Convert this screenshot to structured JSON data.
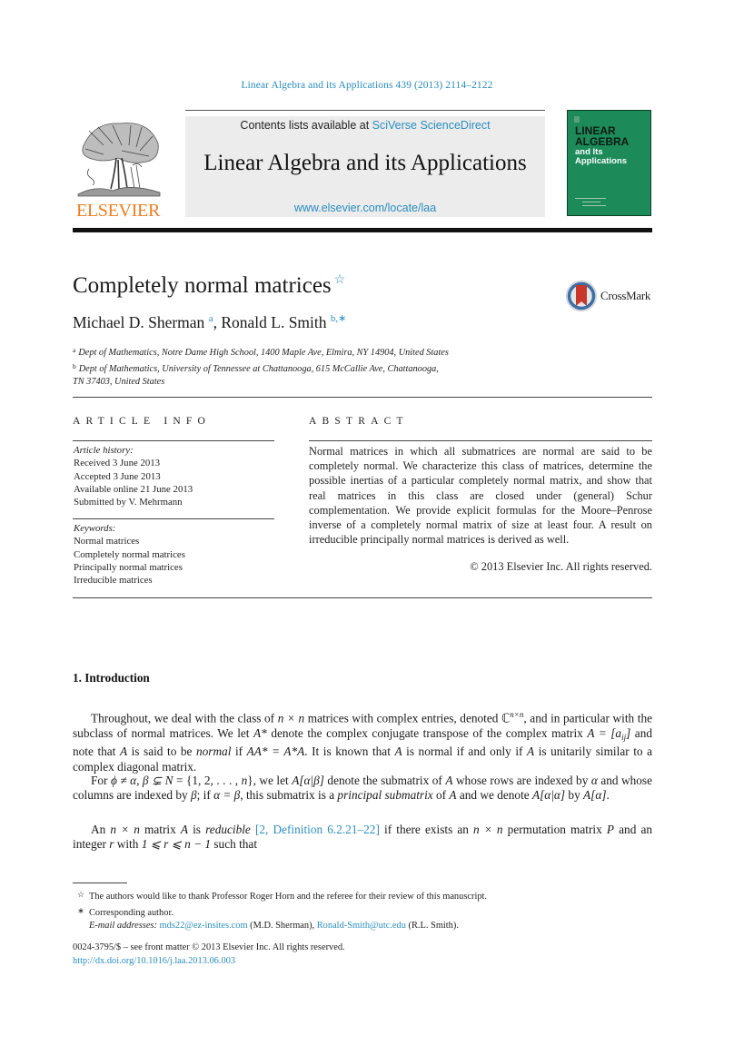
{
  "running_head": "Linear Algebra and its Applications 439 (2013) 2114–2122",
  "masthead": {
    "publisher_logo_text": "ELSEVIER",
    "contents_prefix": "Contents lists available at ",
    "contents_link": "SciVerse ScienceDirect",
    "journal_name": "Linear Algebra and its Applications",
    "journal_url": "www.elsevier.com/locate/laa",
    "cover": {
      "title_line1": "LINEAR",
      "title_line2": "ALGEBRA",
      "subtitle_line1": "and Its",
      "subtitle_line2": "Applications"
    }
  },
  "colors": {
    "link": "#2a8ec0",
    "elsevier_orange": "#f07c1f",
    "cover_green": "#1d8a5a",
    "masthead_gray": "#ececec"
  },
  "article": {
    "title": "Completely normal matrices",
    "title_footnote_mark": "☆",
    "crossmark_label": "CrossMark",
    "authors": [
      {
        "name": "Michael D. Sherman",
        "affiliation_mark": "a"
      },
      {
        "name": "Ronald L. Smith",
        "affiliation_mark": "b,∗"
      }
    ],
    "author_separator": ", ",
    "affiliations": [
      {
        "mark": "a",
        "text": "Dept of Mathematics, Notre Dame High School, 1400 Maple Ave, Elmira, NY 14904, United States"
      },
      {
        "mark": "b",
        "text": "Dept of Mathematics, University of Tennessee at Chattanooga, 615 McCallie Ave, Chattanooga,"
      },
      {
        "mark": "",
        "text": "TN 37403, United States"
      }
    ]
  },
  "article_info": {
    "heading": "ARTICLE INFO",
    "history_label": "Article history:",
    "history": [
      "Received 3 June 2013",
      "Accepted 3 June 2013",
      "Available online 21 June 2013",
      "Submitted by V. Mehrmann"
    ],
    "keywords_label": "Keywords:",
    "keywords": [
      "Normal matrices",
      "Completely normal matrices",
      "Principally normal matrices",
      "Irreducible matrices"
    ]
  },
  "abstract": {
    "heading": "ABSTRACT",
    "text": "Normal matrices in which all submatrices are normal are said to be completely normal. We characterize this class of matrices, de­termine the possible inertias of a particular completely normal matrix, and show that real matrices in this class are closed under (general) Schur complementation. We provide explicit formulas for the Moore–Penrose inverse of a completely normal matrix of size at least four. A result on irreducible principally normal matrices is derived as well.",
    "copyright": "© 2013 Elsevier Inc. All rights reserved."
  },
  "body": {
    "section_heading": "1.  Introduction",
    "para1": {
      "t1": "Throughout, we deal with the class of ",
      "m1": "n × n",
      "t2": " matrices with complex entries, denoted ",
      "m2": "ℂ",
      "m2sup": "n×n",
      "t3": ", and in particular with the subclass of normal matrices. We let ",
      "m3": "A*",
      "t4": " denote the complex conjugate transpose of the complex matrix ",
      "m4": "A = [a",
      "m4sub": "ij",
      "m4end": "]",
      "t5": " and note that ",
      "m5": "A",
      "t6": " is said to be ",
      "e1": "normal",
      "t7": " if ",
      "m6": "AA* = A*A",
      "t8": ". It is known that ",
      "m7": "A",
      "t9": " is normal if and only if ",
      "m8": "A",
      "t10": " is unitarily similar to a complex diagonal matrix."
    },
    "para2": {
      "t1": "For ",
      "m1": "ϕ ≠ α, β ⊊ N",
      "t2": " = {1, 2, . . . , ",
      "m2": "n",
      "t3": "}, we let ",
      "m3": "A[α|β]",
      "t4": " denote the submatrix of ",
      "m4": "A",
      "t5": " whose rows are indexed by ",
      "m5": "α",
      "t6": " and whose columns are indexed by ",
      "m6": "β",
      "t7": "; if ",
      "m7": "α = β",
      "t8": ", this submatrix is a ",
      "e1": "principal submatrix",
      "t9": " of ",
      "m8": "A",
      "t10": " and we denote ",
      "m9": "A[α|α]",
      "t11": " by ",
      "m10": "A[α]",
      "t12": "."
    },
    "para3": {
      "t1": "An ",
      "m1": "n × n",
      "t2": " matrix ",
      "m2": "A",
      "t3": " is ",
      "e1": "reducible",
      "t4": " ",
      "ref": "[2, Definition 6.2.21–22]",
      "t5": " if there exists an ",
      "m3": "n × n",
      "t6": " permutation matrix ",
      "m4": "P",
      "t7": " and an integer ",
      "m5": "r",
      "t8": " with ",
      "m6": "1 ⩽ r ⩽ n − 1",
      "t9": " such that"
    }
  },
  "footnotes": {
    "star_mark": "☆",
    "star_text": "The authors would like to thank Professor Roger Horn and the referee for their review of this manuscript.",
    "corr_mark": "∗",
    "corr_text": "Corresponding author.",
    "email_label": "E-mail addresses:",
    "email1": "mds22@ez-insites.com",
    "email1_owner": " (M.D. Sherman), ",
    "email2": "Ronald-Smith@utc.edu",
    "email2_owner": " (R.L. Smith)."
  },
  "front_matter": {
    "issn_line": "0024-3795/$ – see front matter  © 2013 Elsevier Inc. All rights reserved.",
    "doi": "http://dx.doi.org/10.1016/j.laa.2013.06.003"
  }
}
